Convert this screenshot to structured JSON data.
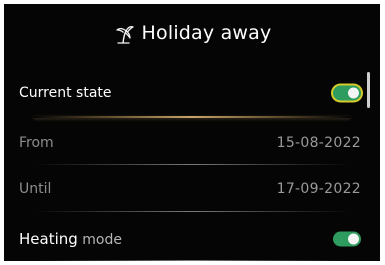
{
  "header": {
    "icon": "palm-tree-icon",
    "title": "Holiday away"
  },
  "rows": {
    "current_state": {
      "label": "Current state",
      "toggle_on": true,
      "focused": true
    },
    "from": {
      "label": "From",
      "value": "15-08-2022"
    },
    "until": {
      "label": "Until",
      "value": "17-09-2022"
    },
    "heating_mode": {
      "label_part1": "Heating",
      "label_part2": "mode",
      "toggle_on": true
    }
  },
  "colors": {
    "background": "#050505",
    "toggle_on": "#2e9b5f",
    "focus_ring": "#d4cc2a",
    "accent_divider": "#c8a46a"
  }
}
